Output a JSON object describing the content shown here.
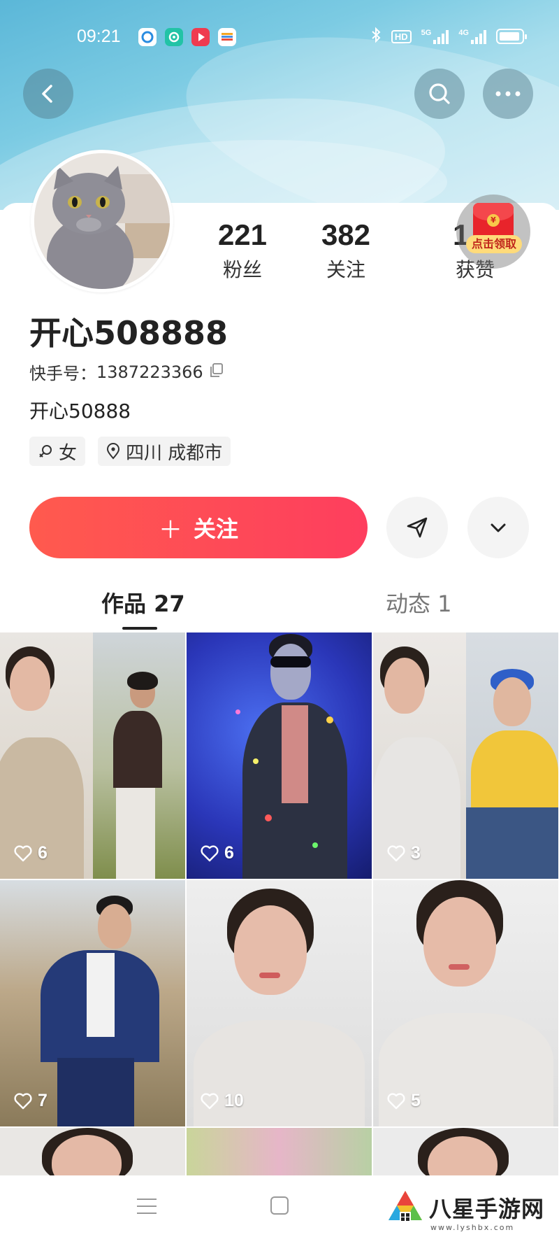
{
  "status_bar": {
    "time": "09:21",
    "network_5g": "5G",
    "network_4g": "4G",
    "hd_label": "HD"
  },
  "header": {
    "back_icon": "chevron-left-icon",
    "search_icon": "search-icon",
    "more_icon": "more-dots-icon"
  },
  "profile": {
    "stats": [
      {
        "value": "221",
        "label": "粉丝"
      },
      {
        "value": "382",
        "label": "关注"
      },
      {
        "value": "1",
        "label": "获赞"
      }
    ],
    "red_packet_label": "点击领取",
    "red_packet_symbol": "¥",
    "name": "开心508888",
    "kwai_id_label": "快手号：",
    "kwai_id": "1387223366",
    "bio": "开心50888",
    "tags": {
      "gender": "女",
      "location": "四川 成都市"
    }
  },
  "actions": {
    "follow_plus": "＋",
    "follow_label": "关注",
    "share_icon": "send-icon",
    "dropdown_icon": "chevron-down-icon"
  },
  "tabs": [
    {
      "label": "作品 27",
      "active": true
    },
    {
      "label": "动态 1",
      "active": false
    }
  ],
  "videos": [
    {
      "likes": "6"
    },
    {
      "likes": "6"
    },
    {
      "likes": "3"
    },
    {
      "likes": "7"
    },
    {
      "likes": "10"
    },
    {
      "likes": "5"
    }
  ],
  "watermark": {
    "text": "八星手游网",
    "sub": "www.lyshbx.com"
  },
  "colors": {
    "follow_gradient_start": "#ff5a4e",
    "follow_gradient_end": "#fe3e5e",
    "banner": "#7ccbe3"
  }
}
